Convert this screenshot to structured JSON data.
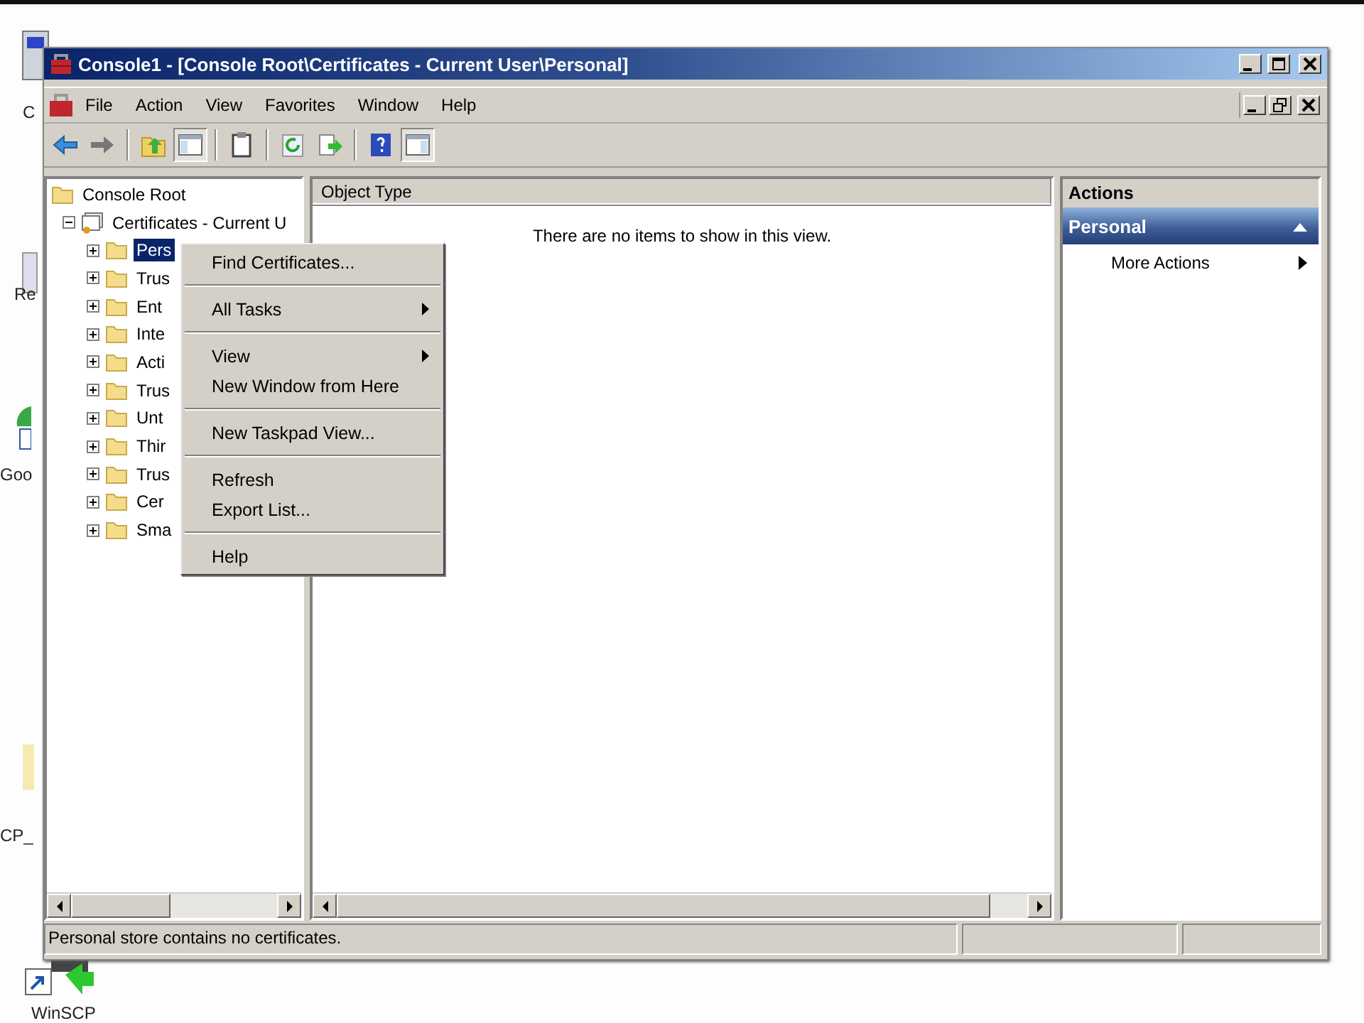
{
  "desktop": [
    {
      "label": "C",
      "kind": "drive"
    },
    {
      "label": "Re",
      "kind": "bin"
    },
    {
      "label": "Goo",
      "kind": "browser"
    },
    {
      "label": "CP_",
      "kind": "file"
    },
    {
      "label": "WinSCP",
      "kind": "shortcut"
    }
  ],
  "window": {
    "title": "Console1 - [Console Root\\Certificates - Current User\\Personal]"
  },
  "menu_bar": [
    "File",
    "Action",
    "View",
    "Favorites",
    "Window",
    "Help"
  ],
  "tree": [
    {
      "label": "Console Root",
      "kind": "folder",
      "selected": false,
      "children": [
        {
          "label": "Certificates - Current U",
          "kind": "certificates",
          "selected": false,
          "expanded": true,
          "children": [
            {
              "label": "Pers",
              "kind": "folder",
              "selected": true,
              "expanded": false
            },
            {
              "label": "Trus",
              "kind": "folder",
              "selected": false,
              "expanded": false
            },
            {
              "label": "Ent",
              "kind": "folder",
              "selected": false,
              "expanded": false
            },
            {
              "label": "Inte",
              "kind": "folder",
              "selected": false,
              "expanded": false
            },
            {
              "label": "Acti",
              "kind": "folder",
              "selected": false,
              "expanded": false
            },
            {
              "label": "Trus",
              "kind": "folder",
              "selected": false,
              "expanded": false
            },
            {
              "label": "Unt",
              "kind": "folder",
              "selected": false,
              "expanded": false
            },
            {
              "label": "Thir",
              "kind": "folder",
              "selected": false,
              "expanded": false
            },
            {
              "label": "Trus",
              "kind": "folder",
              "selected": false,
              "expanded": false
            },
            {
              "label": "Cer",
              "kind": "folder",
              "selected": false,
              "expanded": false
            },
            {
              "label": "Sma",
              "kind": "folder",
              "selected": false,
              "expanded": false
            }
          ]
        }
      ]
    }
  ],
  "list_view": {
    "columns": [
      "Object Type"
    ],
    "empty_message": "There are no items to show in this view."
  },
  "actions": {
    "title": "Actions",
    "section": {
      "label": "Personal",
      "expanded": true
    },
    "items": [
      {
        "label": "More Actions",
        "submenu": true
      }
    ]
  },
  "context_menu": {
    "groups": [
      [
        {
          "label": "Find Certificates...",
          "submenu": false
        }
      ],
      [
        {
          "label": "All Tasks",
          "submenu": true
        }
      ],
      [
        {
          "label": "View",
          "submenu": true
        },
        {
          "label": "New Window from Here",
          "submenu": false
        }
      ],
      [
        {
          "label": "New Taskpad View...",
          "submenu": false
        }
      ],
      [
        {
          "label": "Refresh",
          "submenu": false
        },
        {
          "label": "Export List...",
          "submenu": false
        }
      ],
      [
        {
          "label": "Help",
          "submenu": false
        }
      ]
    ]
  },
  "status_bar": {
    "text": "Personal store contains no certificates."
  }
}
